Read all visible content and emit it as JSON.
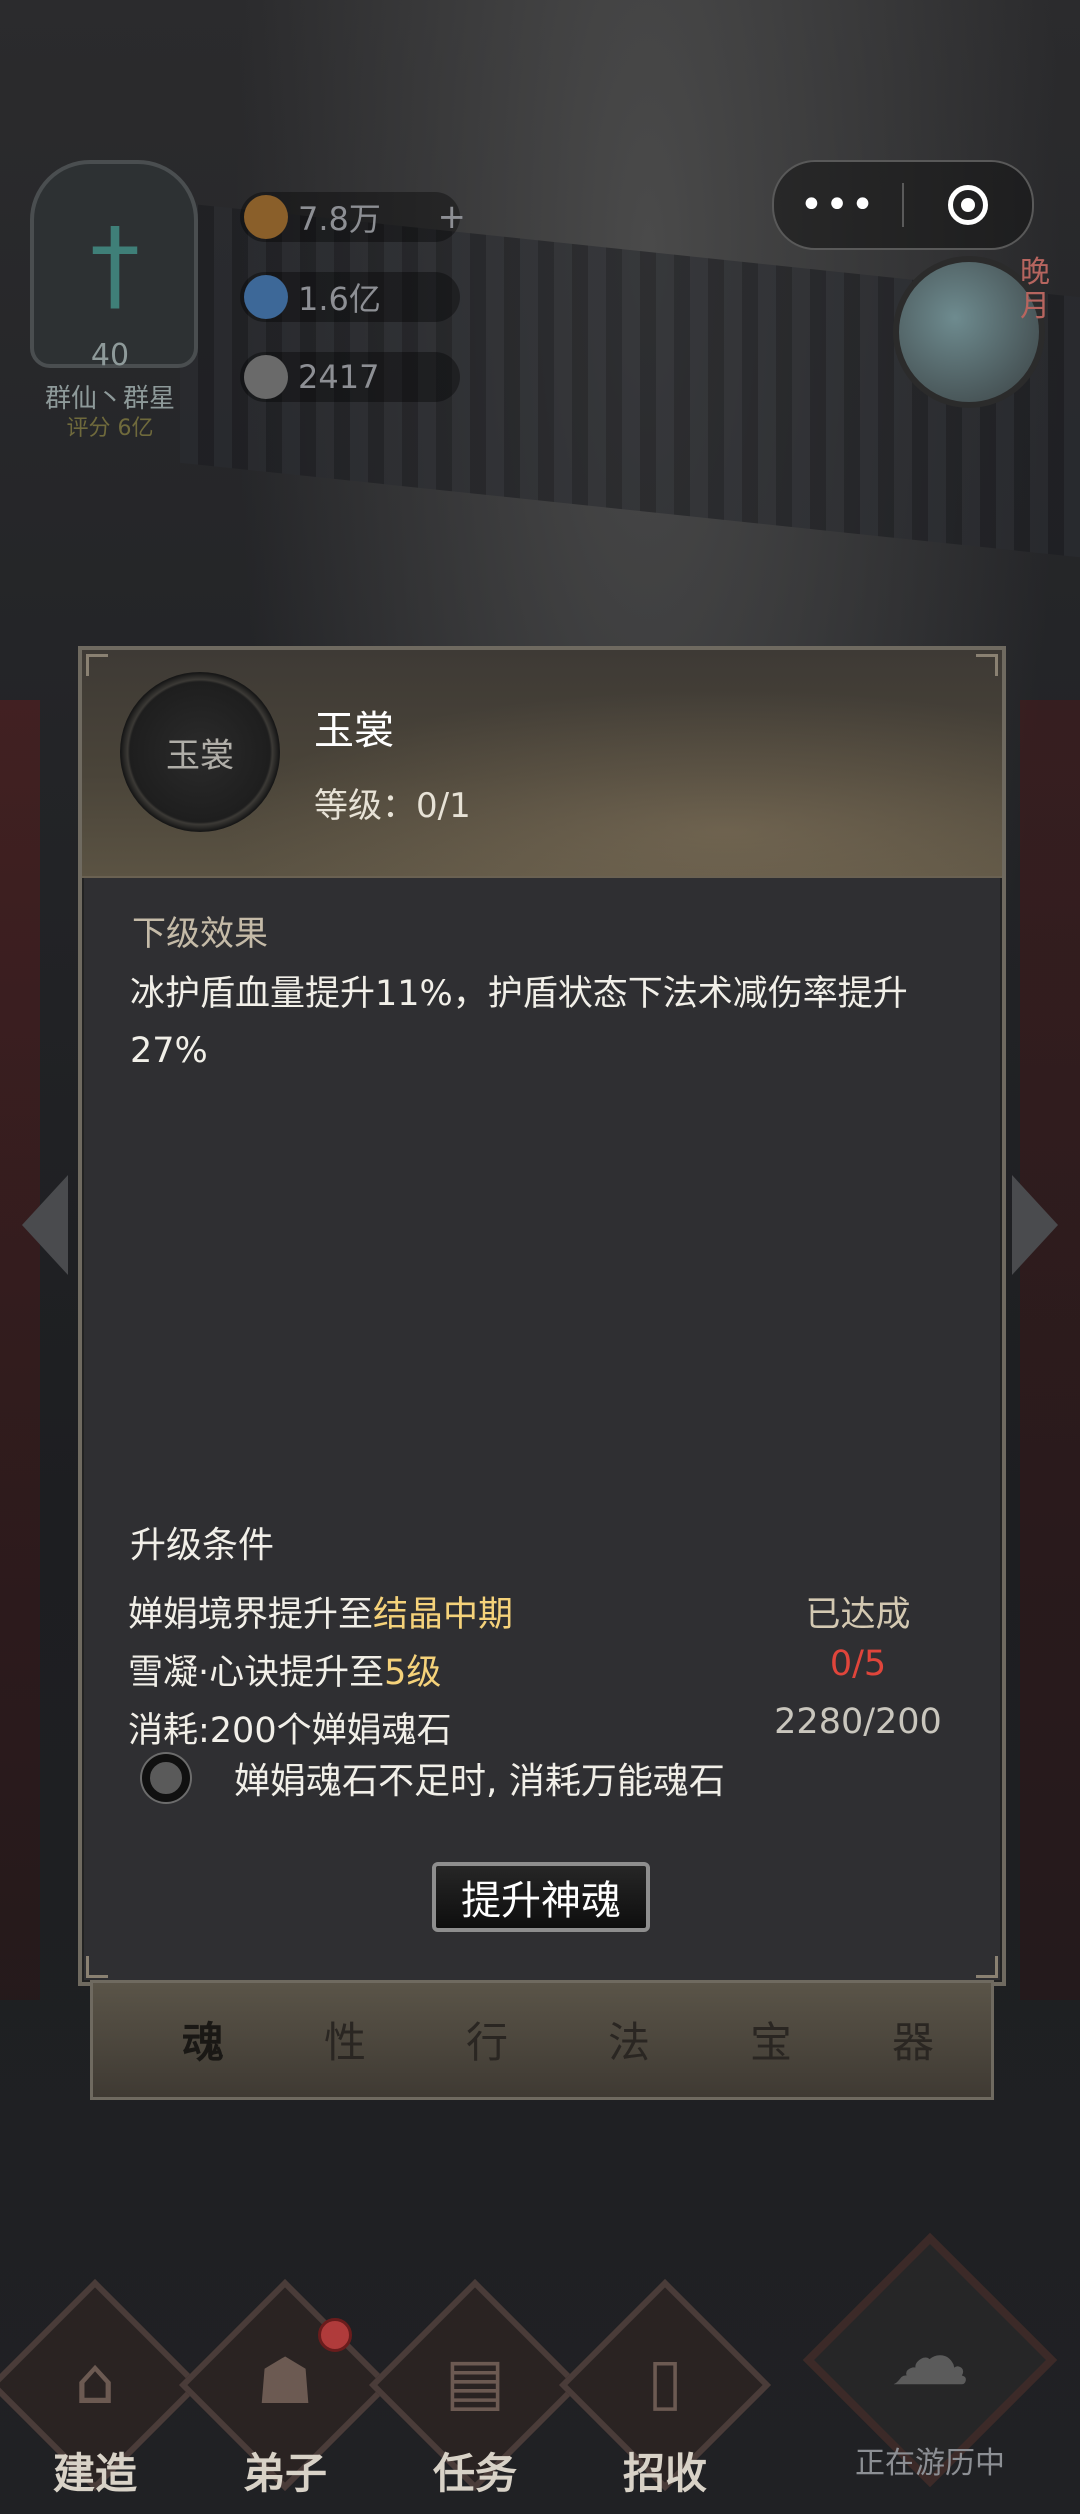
{
  "hud": {
    "guild": {
      "level": "40",
      "name": "群仙丶群星",
      "score": "评分 6亿"
    },
    "resources": [
      {
        "icon": "spirit-stone-icon",
        "value": "7.8万",
        "color": "#c08a3a"
      },
      {
        "icon": "crystal-icon",
        "value": "1.6亿",
        "color": "#4f7fb8"
      },
      {
        "icon": "yin-yang-icon",
        "value": "2417",
        "color": "#9a9a9a"
      }
    ],
    "capsule": {
      "more": "•••"
    },
    "time_tag": "晚\n月"
  },
  "dialog": {
    "badge_text": "玉裳",
    "title": "玉裳",
    "level_label": "等级：0/1",
    "next_effect_label": "下级效果",
    "next_effect_text": "冰护盾血量提升11%，护盾状态下法术减伤率提升27%",
    "conditions_label": "升级条件",
    "conditions": [
      {
        "prefix": "婵娟境界提升至",
        "highlight": "结晶中期",
        "suffix": "",
        "status": "已达成",
        "status_type": "ok"
      },
      {
        "prefix": "雪凝·心诀提升至",
        "highlight": "5级",
        "suffix": "",
        "status": "0/5",
        "status_type": "bad"
      },
      {
        "prefix": "消耗:200个婵娟魂石",
        "highlight": "",
        "suffix": "",
        "status": "2280/200",
        "status_type": "neutral"
      }
    ],
    "toggle_label": "婵娟魂石不足时, 消耗万能魂石",
    "upgrade_button": "提升神魂"
  },
  "tabs": [
    {
      "label": "魂",
      "active": true
    },
    {
      "label": "性",
      "active": false
    },
    {
      "label": "行",
      "active": false
    },
    {
      "label": "法",
      "active": false
    },
    {
      "label": "宝",
      "active": false
    },
    {
      "label": "器",
      "active": false
    }
  ],
  "bottom_nav": [
    {
      "label": "建造",
      "icon": "pavilion-icon"
    },
    {
      "label": "弟子",
      "icon": "disciple-icon",
      "badge": true
    },
    {
      "label": "任务",
      "icon": "scroll-icon"
    },
    {
      "label": "招收",
      "icon": "recruit-card-icon"
    }
  ],
  "travel": {
    "label": "正在游历中"
  }
}
